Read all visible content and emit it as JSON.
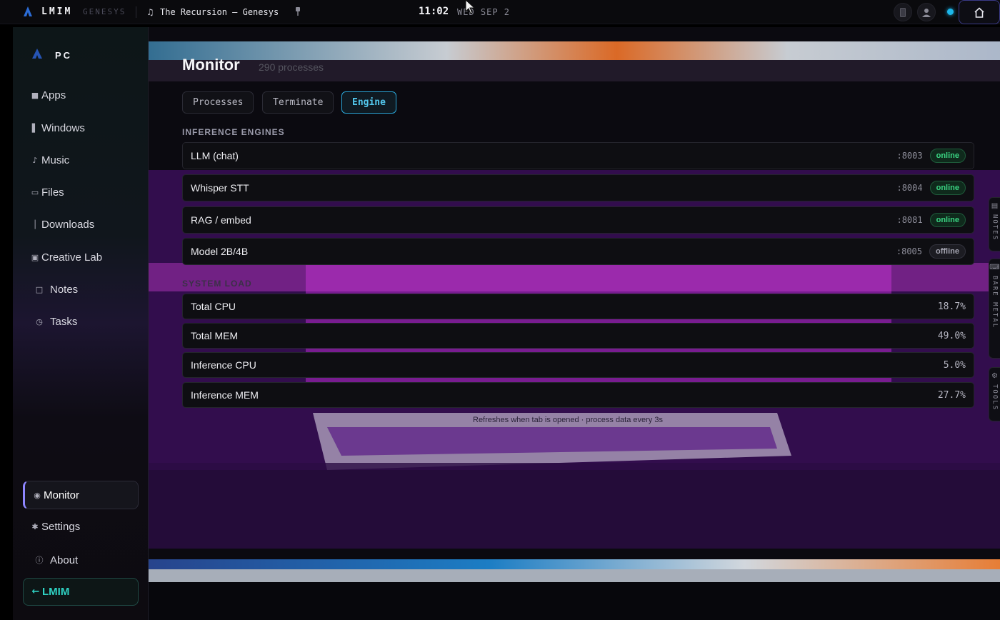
{
  "topbar": {
    "brand": "LMIM",
    "brand_sub": "GENESYS",
    "now_playing": "The Recursion — Genesys",
    "time": "11:02",
    "date": "WED SEP 2"
  },
  "sidebar": {
    "header": "PC",
    "items": [
      {
        "label": "Apps",
        "icon": "■"
      },
      {
        "label": "Windows",
        "icon": "▌"
      },
      {
        "label": "Music",
        "icon": "♪"
      },
      {
        "label": "Files",
        "icon": "▭"
      },
      {
        "label": "Downloads",
        "icon": "│"
      },
      {
        "label": "Creative Lab",
        "icon": "▣"
      },
      {
        "label": "Notes",
        "icon": "□"
      },
      {
        "label": "Tasks",
        "icon": "◷"
      }
    ],
    "bottom_items": [
      {
        "label": "Monitor",
        "icon": "◉"
      },
      {
        "label": "Settings",
        "icon": "✱"
      },
      {
        "label": "About",
        "icon": "ⓘ"
      }
    ],
    "back_label": "LMIM",
    "back_icon": "←"
  },
  "main": {
    "title": "Monitor",
    "subtitle": "290 processes",
    "tabs": [
      "Processes",
      "Terminate",
      "Engine"
    ],
    "active_tab": "Engine",
    "engines_label": "INFERENCE ENGINES",
    "engines": [
      {
        "name": "LLM (chat)",
        "port": ":8003",
        "status": "online"
      },
      {
        "name": "Whisper STT",
        "port": ":8004",
        "status": "online"
      },
      {
        "name": "RAG / embed",
        "port": ":8081",
        "status": "online"
      },
      {
        "name": "Model 2B/4B",
        "port": ":8005",
        "status": "offline"
      }
    ],
    "load_label": "SYSTEM LOAD",
    "load": [
      {
        "name": "Total CPU",
        "value": "18.7%"
      },
      {
        "name": "Total MEM",
        "value": "49.0%"
      },
      {
        "name": "Inference CPU",
        "value": "5.0%"
      },
      {
        "name": "Inference MEM",
        "value": "27.7%"
      }
    ],
    "footnote": "Refreshes when tab is opened · process data every 3s"
  },
  "edge_tabs": [
    "NOTES",
    "BARE METAL",
    "TOOLS"
  ],
  "colors": {
    "accent_cyan": "#2aa6d8",
    "accent_teal": "#2fd3c4",
    "accent_violet": "#8e86ff",
    "online_green": "#3ad482",
    "status_dot": "#1cb6ea"
  }
}
